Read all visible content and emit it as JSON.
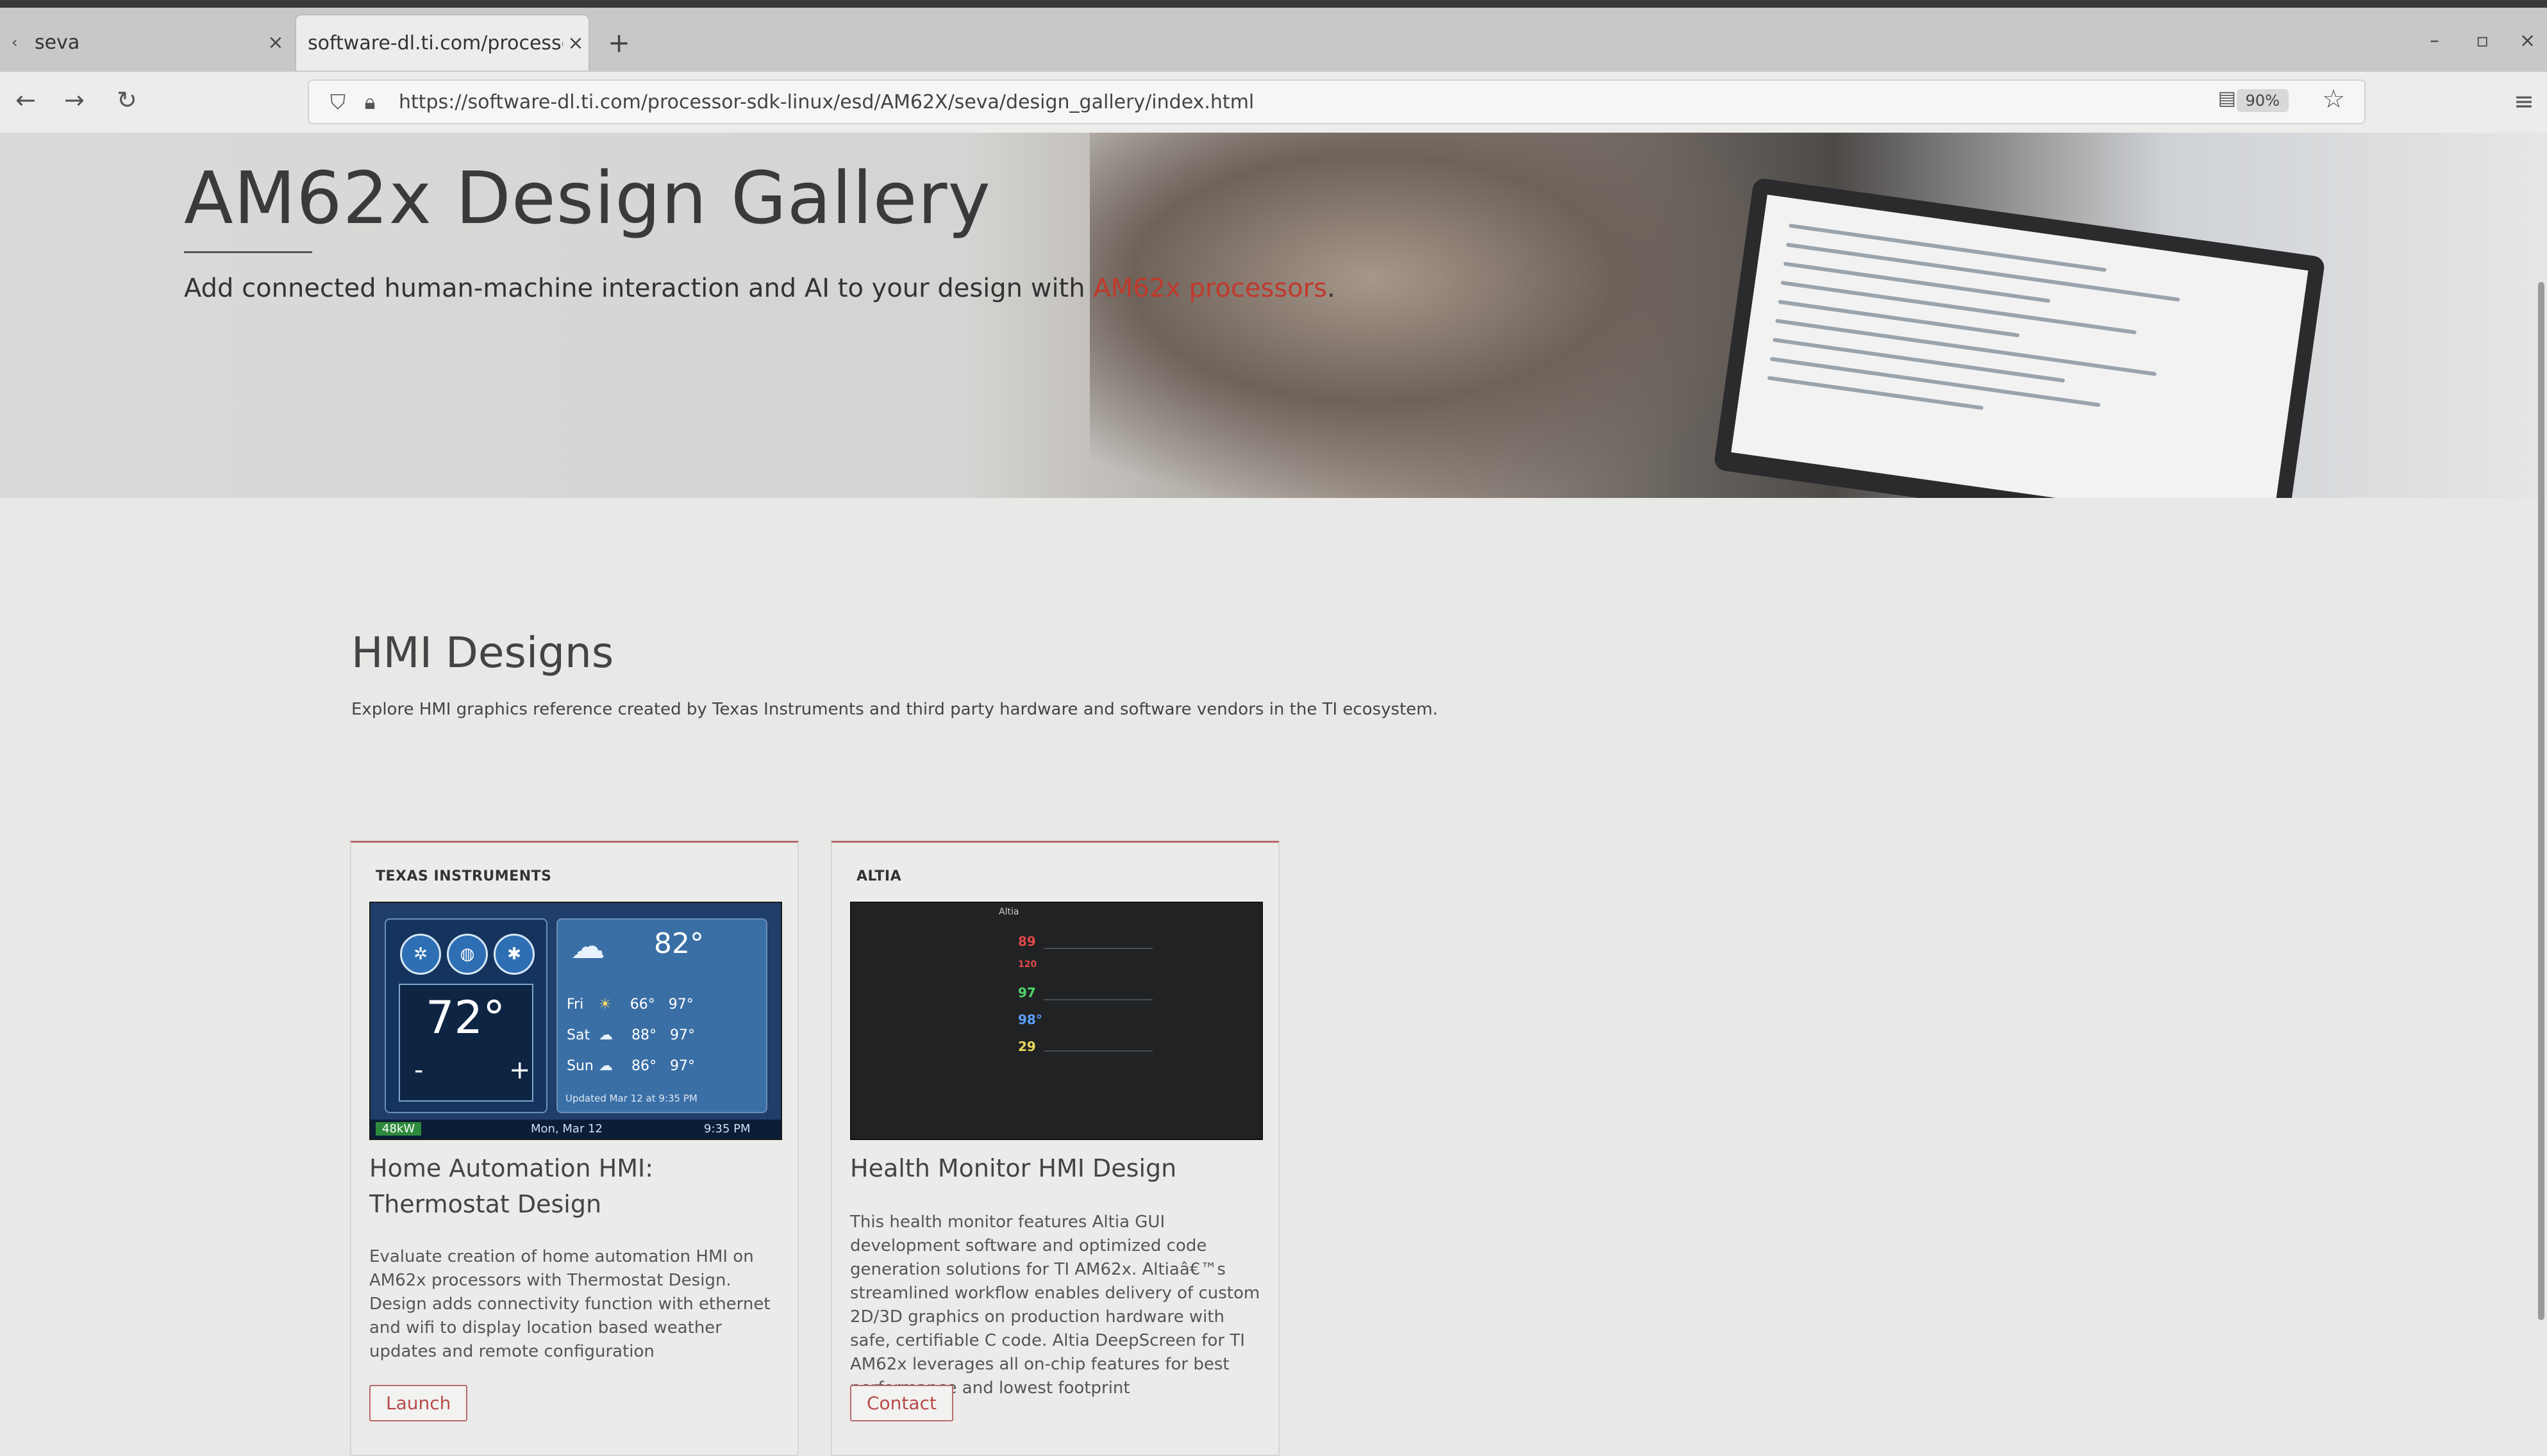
{
  "browser": {
    "tabs": [
      {
        "label": "seva",
        "active": false
      },
      {
        "label": "software-dl.ti.com/processor-",
        "active": true
      }
    ],
    "new_tab_symbol": "+",
    "url": "https://software-dl.ti.com/processor-sdk-linux/esd/AM62X/seva/design_gallery/index.html",
    "zoom": "90%"
  },
  "hero": {
    "title": "AM62x Design Gallery",
    "subtitle_prefix": "Add connected human-machine interaction and AI to your design with ",
    "subtitle_link": "AM62x processors",
    "subtitle_suffix": "."
  },
  "section": {
    "title": "HMI Designs",
    "description": "Explore HMI graphics reference created by Texas Instruments and third party hardware and software vendors in the TI ecosystem."
  },
  "cards": [
    {
      "vendor": "TEXAS INSTRUMENTS",
      "title": "Home Automation HMI: Thermostat Design",
      "description": "Evaluate creation of home automation HMI on AM62x processors with Thermostat Design. Design adds connectivity function with ethernet and wifi to display location based weather updates and remote configuration",
      "button": "Launch",
      "thumb": {
        "indoor_temp": "72°",
        "outdoor_temp": "82°",
        "forecast": [
          {
            "day": "Fri",
            "low": "66°",
            "high": "97°"
          },
          {
            "day": "Sat",
            "low": "88°",
            "high": "97°"
          },
          {
            "day": "Sun",
            "low": "86°",
            "high": "97°"
          }
        ],
        "minus": "-",
        "plus": "+",
        "updated": "Updated Mar 12 at 9:35 PM",
        "badge": "48kW",
        "date": "Mon, Mar 12",
        "time": "9:35 PM"
      }
    },
    {
      "vendor": "ALTIA",
      "title": "Health Monitor HMI Design",
      "description": "This health monitor features Altia GUI development software and optimized code generation solutions for TI AM62x. Altiaâ€™s streamlined workflow enables delivery of custom 2D/3D graphics on production hardware with safe, certifiable C code. Altia DeepScreen for TI AM62x leverages all on-chip features for best performance and lowest footprint",
      "button": "Contact",
      "thumb": {
        "header": "Altia",
        "readings": [
          {
            "value": "89",
            "color": "#e04848"
          },
          {
            "value": "120",
            "color": "#e04848"
          },
          {
            "value": "97",
            "color": "#4fd46b"
          },
          {
            "value": "98°",
            "color": "#5aa0ff"
          },
          {
            "value": "29",
            "color": "#e8d85a"
          }
        ]
      }
    }
  ],
  "colors": {
    "accent": "#c0392b",
    "card_border": "#b86b6b"
  }
}
